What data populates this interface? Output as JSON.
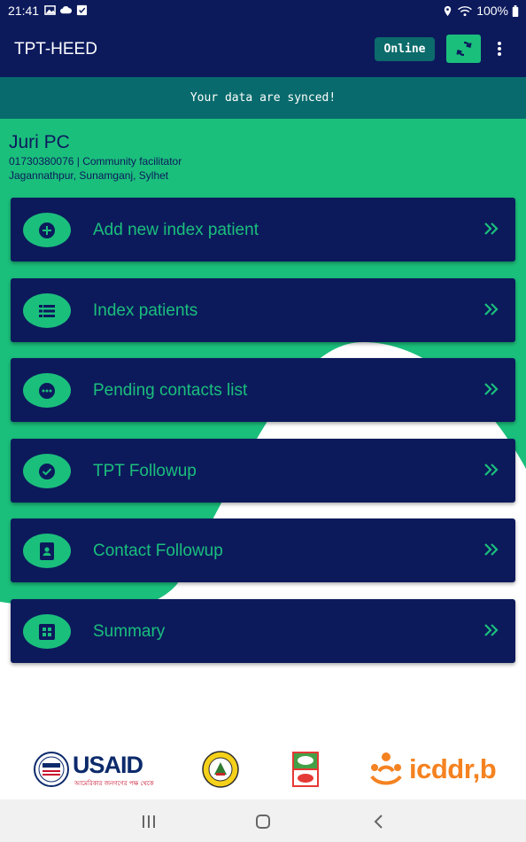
{
  "status_bar": {
    "time": "21:41",
    "battery": "100%"
  },
  "app_bar": {
    "title": "TPT-HEED",
    "status_badge": "Online"
  },
  "sync_banner": "Your data are synced!",
  "profile": {
    "name": "Juri PC",
    "phone_role": "01730380076 | Community facilitator",
    "location": "Jagannathpur, Sunamganj, Sylhet"
  },
  "menu": [
    {
      "label": "Add new index patient",
      "icon": "plus-circle-icon"
    },
    {
      "label": "Index patients",
      "icon": "list-icon"
    },
    {
      "label": "Pending contacts list",
      "icon": "dots-circle-icon"
    },
    {
      "label": "TPT Followup",
      "icon": "check-circle-icon"
    },
    {
      "label": "Contact Followup",
      "icon": "contact-book-icon"
    },
    {
      "label": "Summary",
      "icon": "grid-icon"
    }
  ],
  "logos": {
    "usaid": "USAID",
    "usaid_tagline": "আমেরিকার জনগণের পক্ষ থেকে",
    "icddrb": "icddr,b"
  },
  "colors": {
    "navy": "#0c1a5c",
    "green": "#1bbf7c",
    "teal": "#086a6c"
  }
}
